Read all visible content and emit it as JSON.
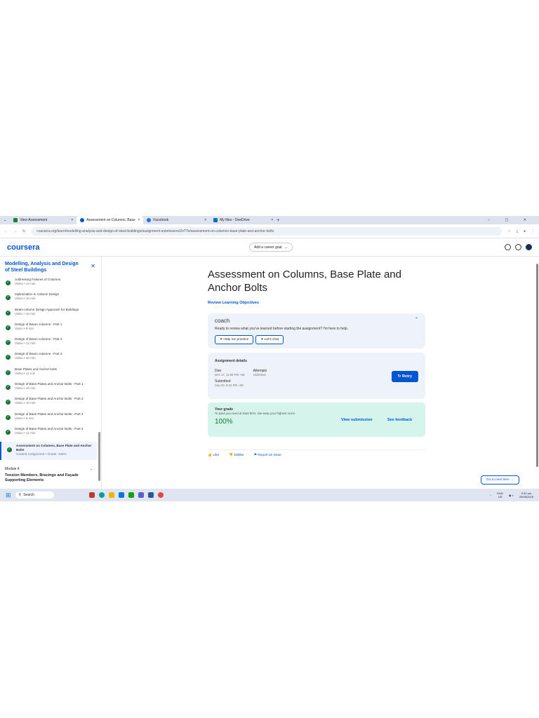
{
  "browser": {
    "tabs": [
      {
        "label": "View Assessment",
        "color": "#1a7f37"
      },
      {
        "label": "Assessment on Columns, Base",
        "color": "#0056d2"
      },
      {
        "label": "Facebook",
        "color": "#1877f2"
      },
      {
        "label": "My files - OneDrive",
        "color": "#0f6cbd"
      }
    ],
    "new_tab": "+",
    "url": "coursera.org/learn/modelling-analysis-and-design-of-steel-buildings/assignment-submission/ZnTTe/assessment-on-columns-base-plate-and-anchor-bolts"
  },
  "header": {
    "logo": "coursera",
    "career_goal": "Add a career goal"
  },
  "sidebar": {
    "course_title": "Modelling, Analysis and Design of Steel Buildings",
    "items": [
      {
        "title": "Addressing Failures of Columns",
        "meta": "Video • 14 min"
      },
      {
        "title": "Optimization in Column Design",
        "meta": "Video • 10 min"
      },
      {
        "title": "Beam-column Design Approach for Buildings",
        "meta": "Video • 15 min"
      },
      {
        "title": "Design of Beam columns - Part 1",
        "meta": "Video • 9 min"
      },
      {
        "title": "Design of Beam columns - Part 2",
        "meta": "Video • 12 min"
      },
      {
        "title": "Design of Beam columns - Part 3",
        "meta": "Video • 10 min"
      },
      {
        "title": "Base Plates and Anchor bolts",
        "meta": "Video • 11 min"
      },
      {
        "title": "Design of Base Plates and Anchor Bolts - Part 1",
        "meta": "Video • 10 min"
      },
      {
        "title": "Design of Base Plates and Anchor Bolts - Part 2",
        "meta": "Video • 10 min"
      },
      {
        "title": "Design of Base Plates and Anchor Bolts - Part 3",
        "meta": "Video • 8 min"
      },
      {
        "title": "Design of Base Plates and Anchor Bolts - Part 4",
        "meta": "Video • 12 min"
      }
    ],
    "current": {
      "title": "Assessment on Columns, Base Plate and Anchor Bolts",
      "meta": "Graded Assignment • Grade: 100%"
    },
    "module": {
      "label": "Module 4",
      "title": "Tension Members, Bracings and Façade Supporting Elements"
    }
  },
  "main": {
    "title": "Assessment on Columns, Base Plate and Anchor Bolts",
    "review_link": "Review Learning Objectives",
    "coach": {
      "title": "coach",
      "text": "Ready to review what you've learned before starting the assignment? I'm here to help.",
      "btn1": "Help me practice",
      "btn2": "Let's chat"
    },
    "details": {
      "heading": "Assignment details",
      "due_label": "Due",
      "due": "Dec 17, 11:59 PM +08",
      "attempts_label": "Attempts",
      "attempts": "Unlimited",
      "submitted_label": "Submitted",
      "submitted": "Sep 29, 9:32 PM +08",
      "retry": "Retry"
    },
    "grade": {
      "label": "Your grade",
      "note": "To pass you need at least 80%. We keep your highest score.",
      "value": "100%",
      "view": "View submission",
      "feedback": "See feedback"
    },
    "feedback": {
      "like": "Like",
      "dislike": "Dislike",
      "report": "Report an issue"
    },
    "next": "Go to next item →"
  },
  "taskbar": {
    "search": "Search",
    "lang": "ENG\nUS",
    "time": "9:32 pm",
    "date": "29/09/2025"
  }
}
